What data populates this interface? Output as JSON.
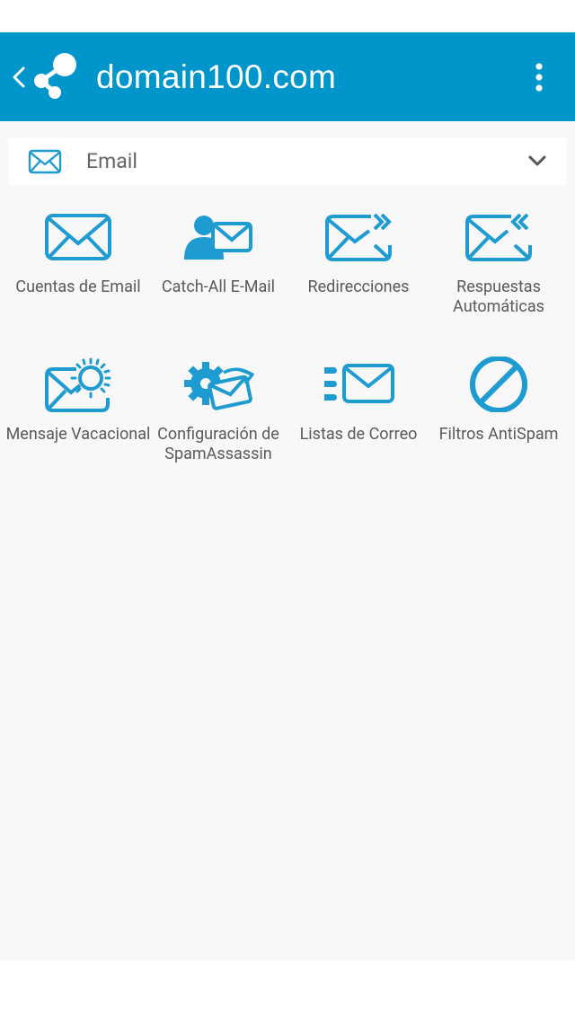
{
  "app": {
    "title": "domain100.com",
    "accent_color": "#0096cc"
  },
  "section": {
    "label": "Email",
    "icon": "envelope-icon"
  },
  "tiles": [
    {
      "label": "Cuentas de Email",
      "icon": "envelope-icon"
    },
    {
      "label": "Catch-All E-Mail",
      "icon": "user-envelope-icon"
    },
    {
      "label": "Redirecciones",
      "icon": "envelope-forward-icon"
    },
    {
      "label": "Respuestas Automáticas",
      "icon": "envelope-reply-icon"
    },
    {
      "label": "Mensaje Vacacional",
      "icon": "envelope-sun-icon"
    },
    {
      "label": "Configuración de SpamAssassin",
      "icon": "gear-envelope-icon"
    },
    {
      "label": "Listas de Correo",
      "icon": "list-envelope-icon"
    },
    {
      "label": "Filtros AntiSpam",
      "icon": "prohibited-icon"
    }
  ]
}
